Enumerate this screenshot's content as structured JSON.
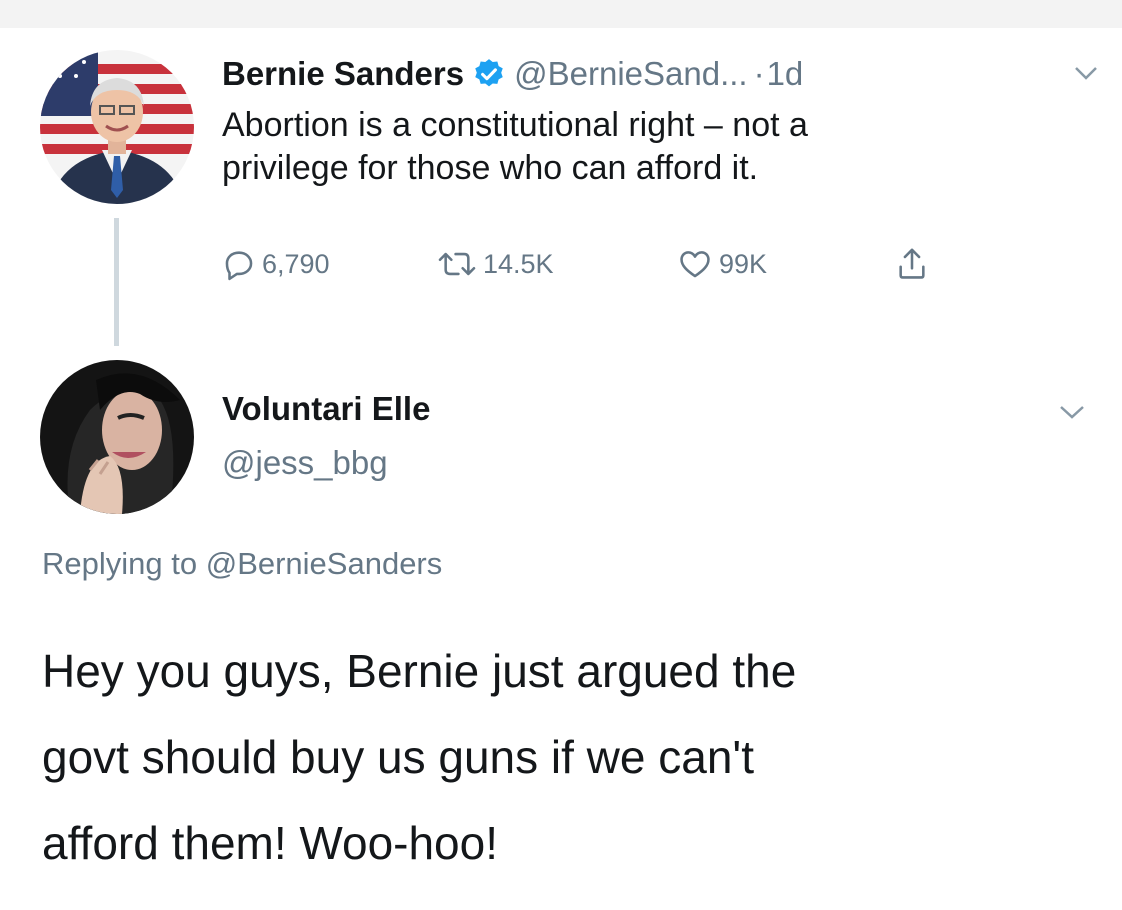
{
  "original_tweet": {
    "author_name": "Bernie Sanders",
    "handle": "@BernieSand...",
    "separator": "·",
    "time": "1d",
    "text": "Abortion is a constitutional right – not a\nprivilege for those who can afford it.",
    "stats": {
      "replies": "6,790",
      "retweets": "14.5K",
      "likes": "99K"
    },
    "icons": [
      "verified-badge-icon",
      "chevron-down-icon",
      "reply-icon",
      "retweet-icon",
      "like-icon",
      "share-icon"
    ]
  },
  "reply_tweet": {
    "author_name": "Voluntari Elle",
    "handle": "@jess_bbg",
    "replying_prefix": "Replying to ",
    "replying_to": "@BernieSanders",
    "text": "Hey you guys, Bernie just argued the\ngovt should buy us guns if we can't\nafford them! Woo-hoo!",
    "icons": [
      "chevron-down-icon"
    ]
  },
  "colors": {
    "text_primary": "#14171a",
    "text_secondary": "#657786",
    "verified_blue": "#1da1f2",
    "thread_line": "#cfd8de"
  }
}
